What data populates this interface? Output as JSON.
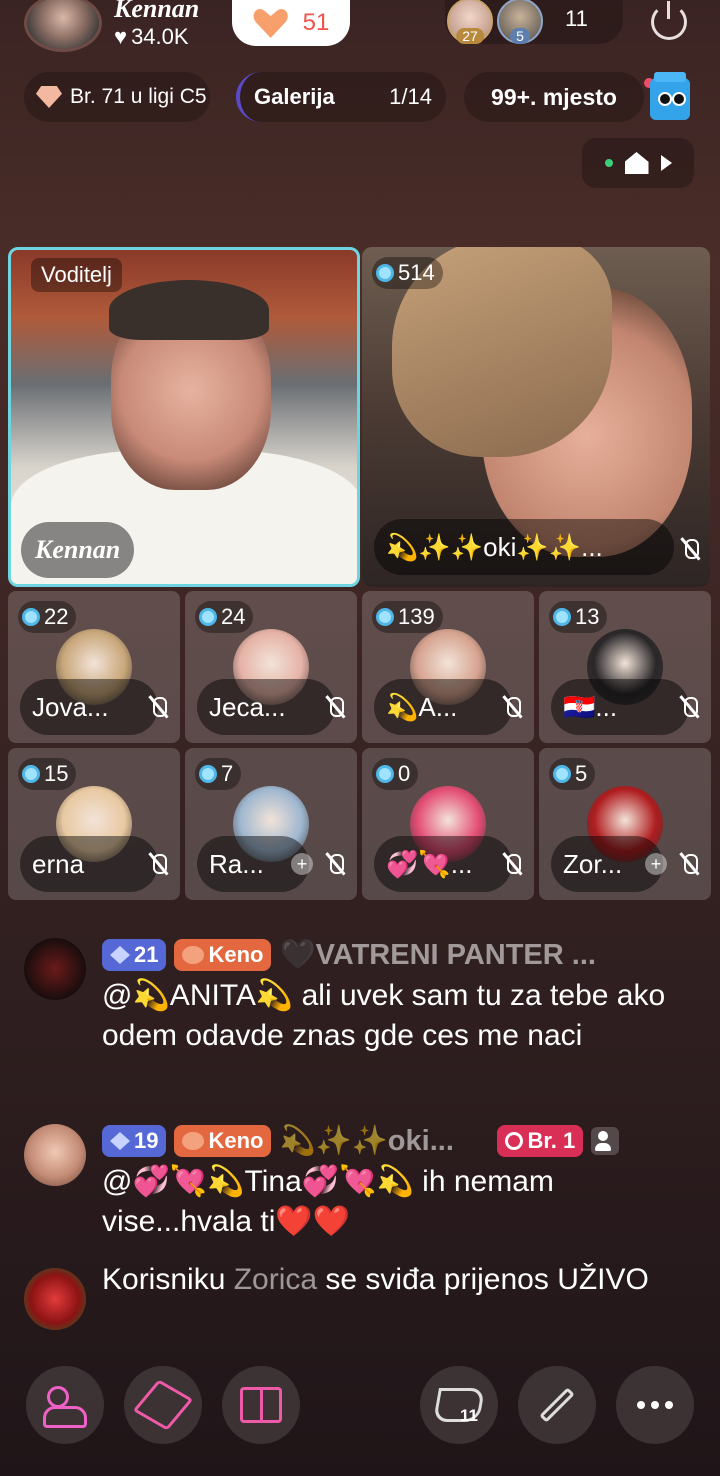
{
  "host": {
    "name": "Kennan",
    "likes": "34.0K"
  },
  "like_button": {
    "count": "51"
  },
  "viewers": {
    "badges": [
      "27",
      "5"
    ],
    "count": "11"
  },
  "info_row": {
    "rank": "Br. 71 u ligi C5",
    "gallery_label": "Galerija",
    "gallery_count": "1/14",
    "place": "99+. mjesto"
  },
  "host_tile": {
    "role": "Voditelj",
    "name": "Kennan"
  },
  "guest_tile": {
    "score": "514",
    "name": "💫✨✨oki✨✨..."
  },
  "small_tiles": [
    {
      "score": "22",
      "name": "Jova...",
      "has_plus": false,
      "color": "#c9a77a"
    },
    {
      "score": "24",
      "name": "Jeca...",
      "has_plus": false,
      "color": "#e6b2a6"
    },
    {
      "score": "139",
      "name": "💫A...",
      "has_plus": false,
      "color": "#d6a38f"
    },
    {
      "score": "13",
      "name": "🇭🇷...",
      "has_plus": false,
      "color": "#2a2729"
    },
    {
      "score": "15",
      "name": "erna",
      "has_plus": false,
      "color": "#e8c9a1"
    },
    {
      "score": "7",
      "name": "Ra...",
      "has_plus": true,
      "color": "#9fb7cf"
    },
    {
      "score": "0",
      "name": "💞💘...",
      "has_plus": false,
      "color": "#e34d74"
    },
    {
      "score": "5",
      "name": "Zor...",
      "has_plus": true,
      "color": "#b01d20"
    }
  ],
  "chat": [
    {
      "level": "21",
      "badge": "Keno",
      "user": "🖤VATRENI PANTER ...",
      "text": "@💫ANITA💫 ali uvek sam tu za tebe ako odem odavde znas gde ces me naci"
    },
    {
      "level": "19",
      "badge": "Keno",
      "user": "💫✨✨oki...",
      "rank_badge": "Br. 1",
      "text": "@💞💘💫Tina💞💘💫 ih nemam vise...hvala ti❤️❤️"
    },
    {
      "prefix": "Korisniku ",
      "user": "Zorica",
      "suffix": " se sviđa prijenos UŽIVO"
    }
  ],
  "bottom_bar": {
    "share_count": "11"
  },
  "colors": {
    "accent_cyan": "#6ed4e0",
    "level_blue": "#5568d6",
    "keno_orange": "#e36840",
    "rank_red": "#d92e55"
  }
}
